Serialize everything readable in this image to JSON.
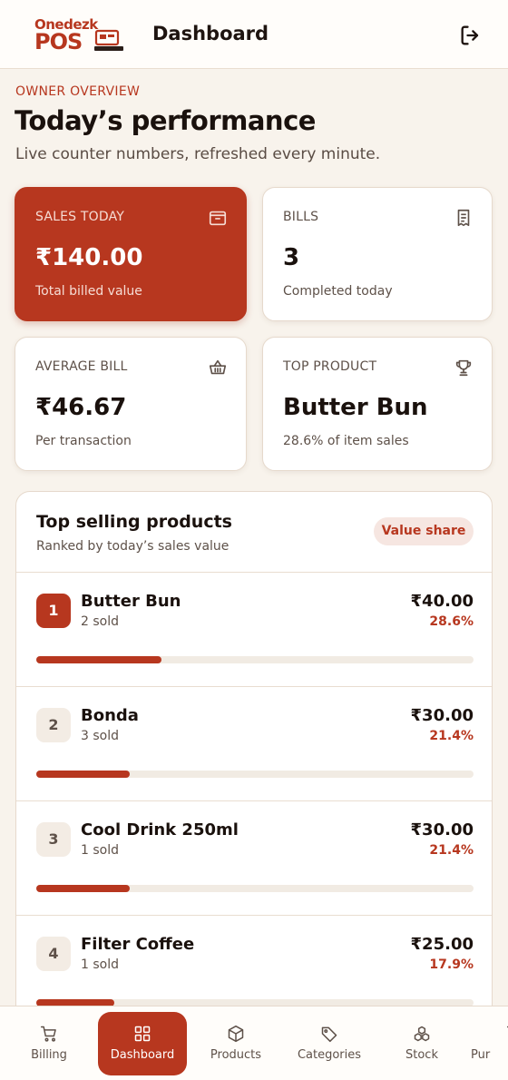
{
  "header": {
    "logo_top": "Onedezk",
    "logo_bottom": "POS",
    "title": "Dashboard",
    "logout_icon": "logout-icon"
  },
  "intro": {
    "eyebrow": "OWNER OVERVIEW",
    "title": "Today’s performance",
    "subtitle": "Live counter numbers, refreshed every minute."
  },
  "kpis": [
    {
      "label": "SALES TODAY",
      "value": "₹140.00",
      "sub": "Total billed value",
      "icon": "wallet-icon"
    },
    {
      "label": "BILLS",
      "value": "3",
      "sub": "Completed today",
      "icon": "receipt-icon"
    },
    {
      "label": "AVERAGE BILL",
      "value": "₹46.67",
      "sub": "Per transaction",
      "icon": "basket-icon"
    },
    {
      "label": "TOP PRODUCT",
      "value": "Butter Bun",
      "sub": "28.6% of item sales",
      "icon": "trophy-icon"
    }
  ],
  "top_products": {
    "title": "Top selling products",
    "subtitle": "Ranked by today’s sales value",
    "badge": "Value share",
    "items": [
      {
        "rank": "1",
        "name": "Butter Bun",
        "sold": "2 sold",
        "value": "₹40.00",
        "share": "28.6%",
        "share_fraction": 0.286
      },
      {
        "rank": "2",
        "name": "Bonda",
        "sold": "3 sold",
        "value": "₹30.00",
        "share": "21.4%",
        "share_fraction": 0.214
      },
      {
        "rank": "3",
        "name": "Cool Drink 250ml",
        "sold": "1 sold",
        "value": "₹30.00",
        "share": "21.4%",
        "share_fraction": 0.214
      },
      {
        "rank": "4",
        "name": "Filter Coffee",
        "sold": "1 sold",
        "value": "₹25.00",
        "share": "17.9%",
        "share_fraction": 0.179
      }
    ]
  },
  "nav": {
    "items": [
      {
        "label": "Billing",
        "icon": "cart-icon"
      },
      {
        "label": "Dashboard",
        "icon": "grid-icon",
        "active": true
      },
      {
        "label": "Products",
        "icon": "box-icon"
      },
      {
        "label": "Categories",
        "icon": "tag-icon"
      },
      {
        "label": "Stock",
        "icon": "stack-icon"
      },
      {
        "label": "Pur",
        "icon": "cart-icon"
      }
    ]
  },
  "colors": {
    "accent": "#b7371f",
    "background": "#f8f3ec",
    "surface": "#ffffff",
    "text": "#1a110d",
    "muted": "#5e5149"
  }
}
